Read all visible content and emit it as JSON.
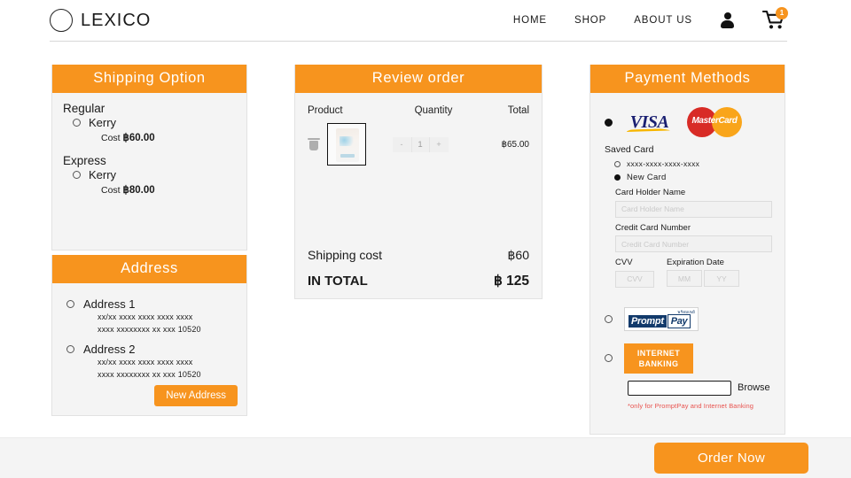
{
  "header": {
    "brand": "LEXICO",
    "nav": [
      {
        "label": "HOME"
      },
      {
        "label": "SHOP"
      },
      {
        "label": "ABOUT US"
      }
    ],
    "account_icon": "user-icon",
    "cart_icon": "cart-icon",
    "cart_badge": "1"
  },
  "shipping": {
    "title": "Shipping Option",
    "groups": [
      {
        "group_label": "Regular",
        "carrier": "Kerry",
        "cost_label": "Cost",
        "cost_value": "฿60.00",
        "selected": false
      },
      {
        "group_label": "Express",
        "carrier": "Kerry",
        "cost_label": "Cost",
        "cost_value": "฿80.00",
        "selected": false
      }
    ]
  },
  "address": {
    "title": "Address",
    "items": [
      {
        "label": "Address 1",
        "line1": "xx/xx xxxx xxxx xxxx xxxx",
        "line2": "xxxx xxxxxxxx xx xxx 10520",
        "selected": false
      },
      {
        "label": "Address 2",
        "line1": "xx/xx xxxx xxxx xxxx xxxx",
        "line2": "xxxx xxxxxxxx xx xxx 10520",
        "selected": false
      }
    ],
    "new_address_button": "New Address"
  },
  "review": {
    "title": "Review order",
    "columns": {
      "product": "Product",
      "quantity": "Quantity",
      "total": "Total"
    },
    "items": [
      {
        "delete_icon": "trash-icon",
        "thumbnail": "product-thumbnail",
        "qty_decrement": "-",
        "qty_value": "1",
        "qty_increment": "+",
        "line_total": "฿65.00"
      }
    ],
    "shipping_cost_label": "Shipping cost",
    "shipping_cost_value": "฿60",
    "grand_total_label": "IN TOTAL",
    "grand_total_value": "฿ 125"
  },
  "payment": {
    "title": "Payment Methods",
    "card_method": {
      "selected": true,
      "logos": [
        {
          "name": "visa-logo",
          "text": "VISA"
        },
        {
          "name": "mastercard-logo",
          "text": "MasterCard"
        }
      ],
      "saved_card_label": "Saved Card",
      "saved_card_number": "xxxx-xxxx-xxxx-xxxx",
      "saved_card_selected": false,
      "new_card_label": "New Card",
      "new_card_selected": true,
      "fields": {
        "holder_label": "Card Holder Name",
        "holder_placeholder": "Card Holder Name",
        "holder_value": "",
        "number_label": "Credit Card Number",
        "number_placeholder": "Credit Card Number",
        "number_value": "",
        "cvv_label": "CVV",
        "cvv_placeholder": "CVV",
        "cvv_value": "",
        "expiration_label": "Expiration Date",
        "month_placeholder": "MM",
        "month_value": "",
        "year_placeholder": "YY",
        "year_value": ""
      }
    },
    "promptpay": {
      "selected": false,
      "logo_prompt": "Prompt",
      "logo_pay": "Pay",
      "logo_thai": "พร้อมเพย์"
    },
    "internet_banking": {
      "selected": false,
      "line1": "INTERNET",
      "line2": "BANKING"
    },
    "upload": {
      "input_value": "",
      "browse_label": "Browse",
      "note": "*only for PromptPay and Internet Banking"
    }
  },
  "footer": {
    "order_button": "Order Now"
  },
  "colors": {
    "accent": "#F7941E",
    "panel_bg": "#f4f4f4",
    "text": "#1a1a1a",
    "note_red": "#e8534f",
    "visa_blue": "#1A1F71",
    "mastercard_red": "#D82B26",
    "mastercard_orange": "#F9A51A",
    "promptpay_navy": "#123A6B"
  }
}
